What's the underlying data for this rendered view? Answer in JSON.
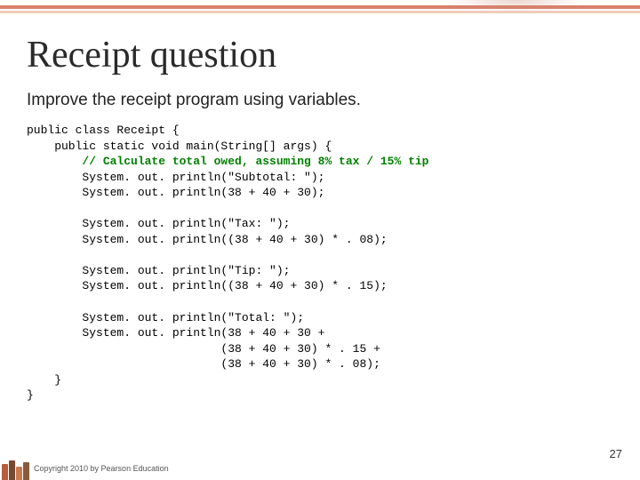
{
  "slide": {
    "title": "Receipt question",
    "subtitle": "Improve the receipt program using variables.",
    "page_number": "27",
    "copyright": "Copyright 2010 by Pearson Education"
  },
  "code": {
    "l01": "public class Receipt {",
    "l02": "    public static void main(String[] args) {",
    "l03_comment": "        // Calculate total owed, assuming 8% tax / 15% tip",
    "l04": "        System. out. println(\"Subtotal: \");",
    "l05": "        System. out. println(38 + 40 + 30);",
    "l06": "",
    "l07": "        System. out. println(\"Tax: \");",
    "l08": "        System. out. println((38 + 40 + 30) * . 08);",
    "l09": "",
    "l10": "        System. out. println(\"Tip: \");",
    "l11": "        System. out. println((38 + 40 + 30) * . 15);",
    "l12": "",
    "l13": "        System. out. println(\"Total: \");",
    "l14": "        System. out. println(38 + 40 + 30 +",
    "l15": "                            (38 + 40 + 30) * . 15 +",
    "l16": "                            (38 + 40 + 30) * . 08);",
    "l17": "    }",
    "l18": "}"
  }
}
